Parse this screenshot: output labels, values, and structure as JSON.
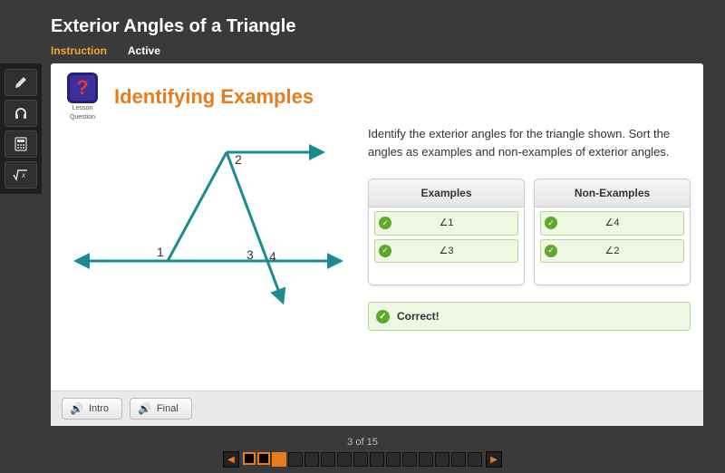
{
  "header": {
    "title": "Exterior Angles of a Triangle",
    "tabs": {
      "instruction": "Instruction",
      "active": "Active"
    }
  },
  "sidebar": {
    "pencil": "pencil-icon",
    "headphones": "headphones-icon",
    "calculator": "calculator-icon",
    "formula": "formula-icon"
  },
  "lesson": {
    "badge_symbol": "?",
    "badge_line1": "Lesson",
    "badge_line2": "Question",
    "title": "Identifying Examples"
  },
  "diagram": {
    "labels": {
      "a1": "1",
      "a2": "2",
      "a3": "3",
      "a4": "4"
    }
  },
  "instruction": {
    "text": "Identify the exterior angles for the triangle shown. Sort the angles as examples and non-examples of exterior angles."
  },
  "sort": {
    "examples_header": "Examples",
    "nonexamples_header": "Non-Examples",
    "examples": [
      {
        "label": "∠1"
      },
      {
        "label": "∠3"
      }
    ],
    "nonexamples": [
      {
        "label": "∠4"
      },
      {
        "label": "∠2"
      }
    ]
  },
  "feedback": {
    "text": "Correct!"
  },
  "audio": {
    "intro": "Intro",
    "final": "Final"
  },
  "pager": {
    "label": "3 of 15",
    "total": 15,
    "current": 3
  }
}
